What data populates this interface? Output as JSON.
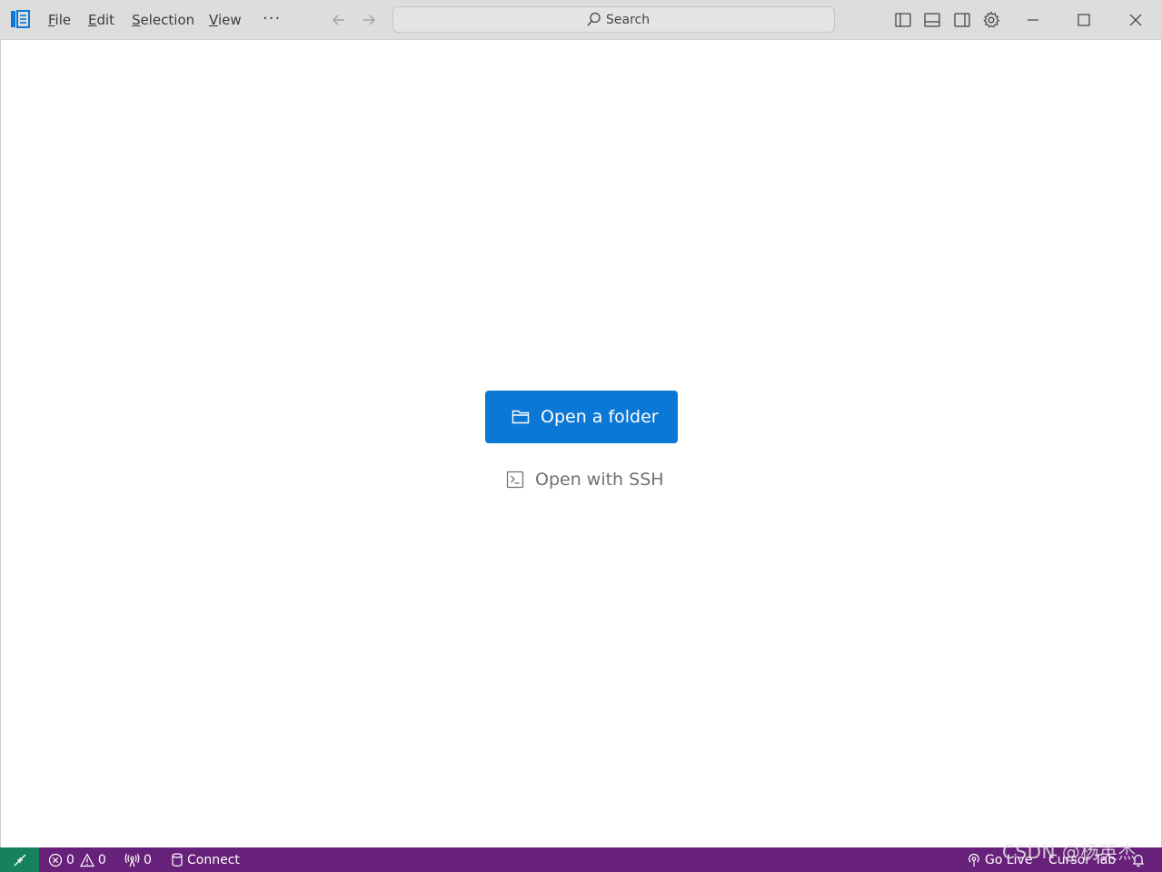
{
  "titlebar": {
    "menu": [
      {
        "label": "File",
        "mnemonic": "F",
        "rest": "ile"
      },
      {
        "label": "Edit",
        "mnemonic": "E",
        "rest": "dit"
      },
      {
        "label": "Selection",
        "mnemonic": "S",
        "rest": "election"
      },
      {
        "label": "View",
        "mnemonic": "V",
        "rest": "iew"
      }
    ],
    "more_label": "···",
    "search_label": "Search",
    "icons": [
      "app-icon",
      "back-arrow-icon",
      "forward-arrow-icon",
      "search-icon",
      "toggle-primary-sidebar-icon",
      "toggle-panel-icon",
      "toggle-secondary-sidebar-icon",
      "settings-gear-icon",
      "minimize-icon",
      "maximize-icon",
      "close-icon"
    ]
  },
  "main": {
    "open_folder_label": "Open a folder",
    "open_ssh_label": "Open with SSH",
    "accent_color": "#0a78d4"
  },
  "statusbar": {
    "bg_color": "#68217a",
    "remote_color": "#16825d",
    "errors": "0",
    "warnings": "0",
    "ports": "0",
    "connect_label": "Connect",
    "go_live_label": "Go Live",
    "cursor_tab_label": "Cursor Tab"
  },
  "watermark": "CSDN @杨英杰"
}
